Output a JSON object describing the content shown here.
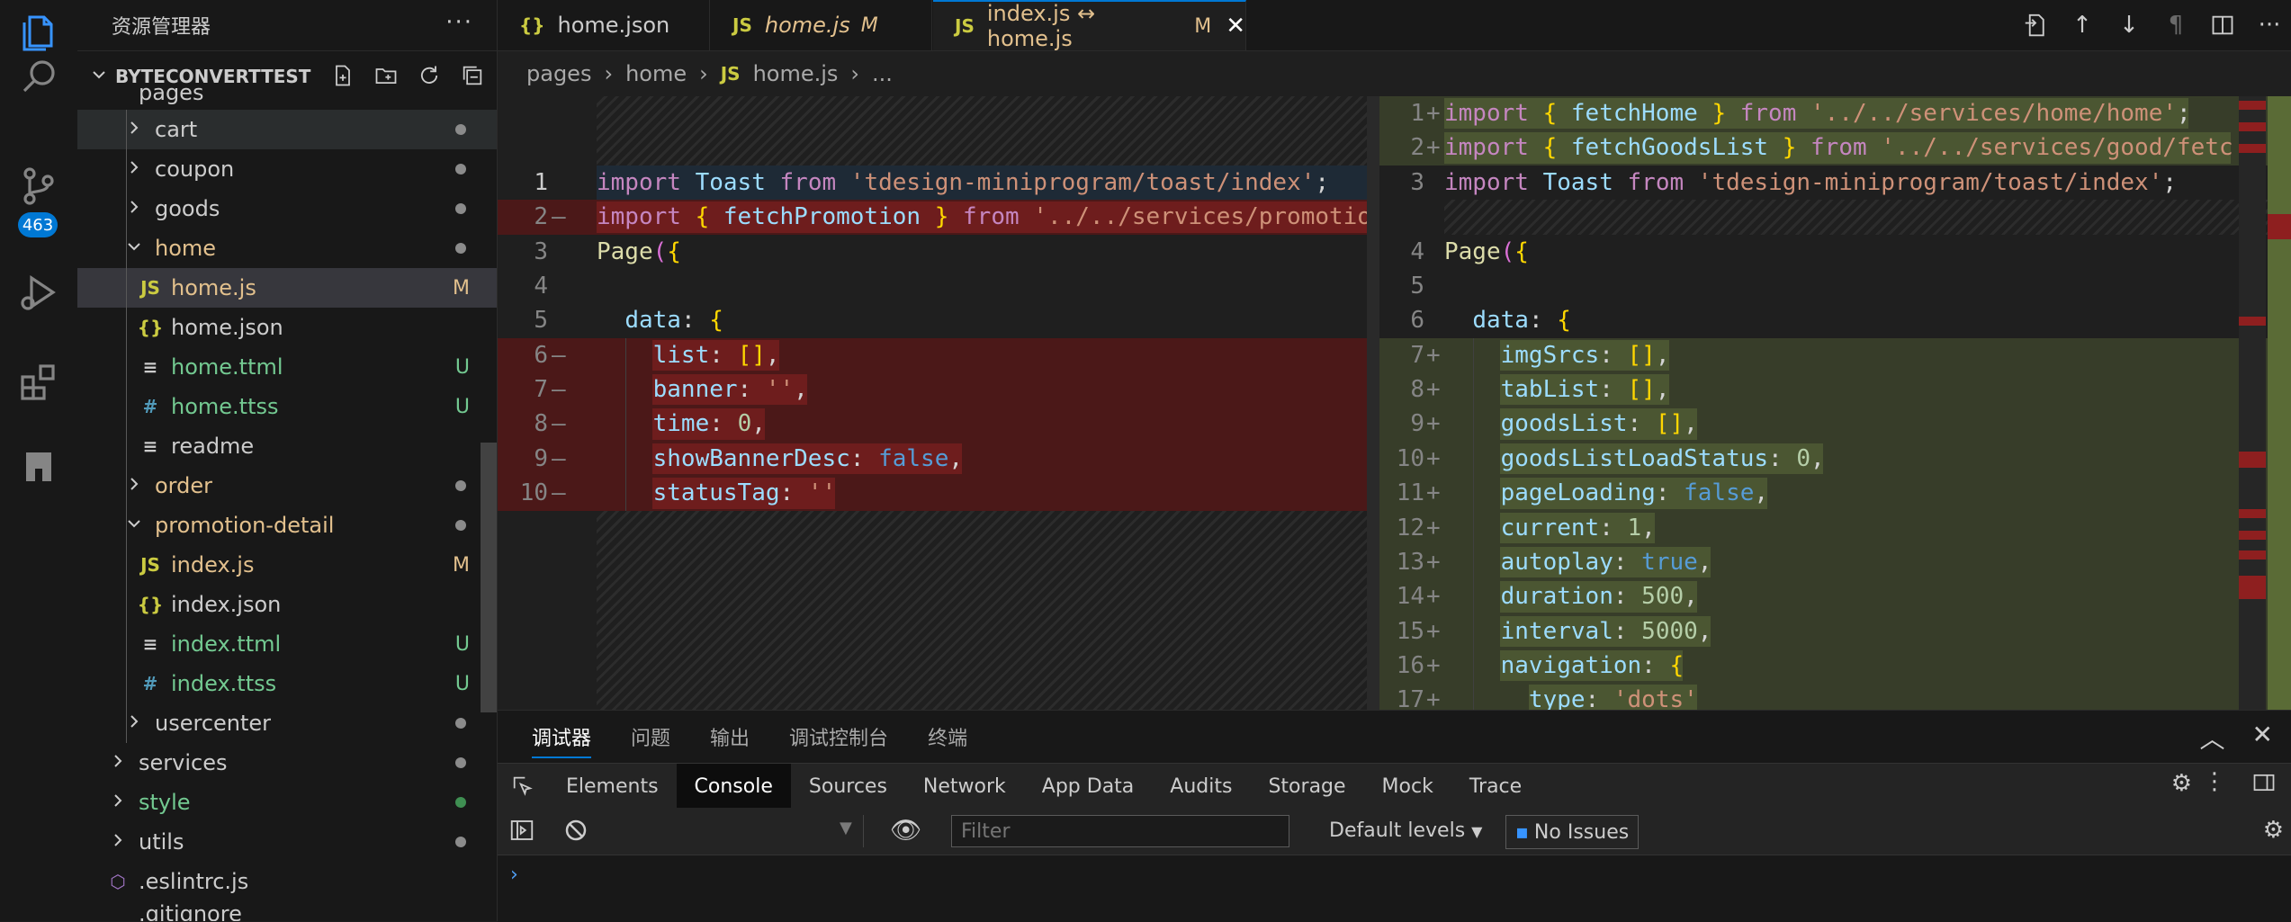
{
  "activity": {
    "items": [
      "explorer",
      "search",
      "source-control",
      "run-debug",
      "extensions",
      "mini-program"
    ],
    "scm_badge": "463"
  },
  "sidebar": {
    "title": "资源管理器",
    "more": "···",
    "project": "BYTECONVERTTEST",
    "partial_top": "pages",
    "partial_bottom": ".gitignore",
    "tree": [
      {
        "label": "cart",
        "type": "folder",
        "open": false,
        "level": 1,
        "status": "dot",
        "color": "#cccccc"
      },
      {
        "label": "coupon",
        "type": "folder",
        "open": false,
        "level": 1,
        "status": "dot",
        "color": "#cccccc"
      },
      {
        "label": "goods",
        "type": "folder",
        "open": false,
        "level": 1,
        "status": "dot",
        "color": "#cccccc"
      },
      {
        "label": "home",
        "type": "folder",
        "open": true,
        "level": 1,
        "status": "dot",
        "color": "#e2c08d"
      },
      {
        "label": "home.js",
        "type": "js",
        "level": 2,
        "status": "M",
        "color": "#e2c08d"
      },
      {
        "label": "home.json",
        "type": "json",
        "level": 2,
        "status": "",
        "color": "#cccccc"
      },
      {
        "label": "home.ttml",
        "type": "ttml",
        "level": 2,
        "status": "U",
        "color": "#73c991"
      },
      {
        "label": "home.ttss",
        "type": "ttss",
        "level": 2,
        "status": "U",
        "color": "#73c991"
      },
      {
        "label": "readme",
        "type": "text",
        "level": 2,
        "status": "",
        "color": "#cccccc"
      },
      {
        "label": "order",
        "type": "folder",
        "open": false,
        "level": 1,
        "status": "dot",
        "color": "#e2c08d"
      },
      {
        "label": "promotion-detail",
        "type": "folder",
        "open": true,
        "level": 1,
        "status": "dot",
        "color": "#e2c08d"
      },
      {
        "label": "index.js",
        "type": "js",
        "level": 2,
        "status": "M",
        "color": "#e2c08d"
      },
      {
        "label": "index.json",
        "type": "json",
        "level": 2,
        "status": "",
        "color": "#cccccc"
      },
      {
        "label": "index.ttml",
        "type": "ttml",
        "level": 2,
        "status": "U",
        "color": "#73c991"
      },
      {
        "label": "index.ttss",
        "type": "ttss",
        "level": 2,
        "status": "U",
        "color": "#73c991"
      },
      {
        "label": "usercenter",
        "type": "folder",
        "open": false,
        "level": 1,
        "status": "dot",
        "color": "#cccccc"
      },
      {
        "label": "services",
        "type": "folder",
        "open": false,
        "level": 0,
        "status": "dot",
        "color": "#cccccc"
      },
      {
        "label": "style",
        "type": "folder",
        "open": false,
        "level": 0,
        "status": "dot-green",
        "color": "#73c991"
      },
      {
        "label": "utils",
        "type": "folder",
        "open": false,
        "level": 0,
        "status": "dot",
        "color": "#cccccc"
      },
      {
        "label": ".eslintrc.js",
        "type": "eslint",
        "level": 0,
        "status": "",
        "color": "#cccccc"
      }
    ]
  },
  "tabs": [
    {
      "icon": "{}",
      "label": "home.json",
      "modified": "",
      "active": false,
      "italic": false
    },
    {
      "icon": "JS",
      "label": "home.js",
      "modified": "M",
      "active": false,
      "italic": true
    },
    {
      "icon": "JS",
      "label": "index.js ↔ home.js",
      "modified": "M",
      "active": true,
      "italic": false
    }
  ],
  "breadcrumb": [
    "pages",
    "home",
    "home.js",
    "..."
  ],
  "left_pane": {
    "lines": [
      {
        "n": "1",
        "marker": "",
        "code": "import Toast from 'tdesign-miniprogram/toast/index';"
      },
      {
        "n": "2",
        "marker": "—",
        "code": "import { fetchPromotion } from '../../services/promotion"
      },
      {
        "n": "3",
        "marker": "",
        "code": "Page({"
      },
      {
        "n": "4",
        "marker": "",
        "code": ""
      },
      {
        "n": "5",
        "marker": "",
        "code": "  data: {"
      },
      {
        "n": "6",
        "marker": "—",
        "code": "    list: [],"
      },
      {
        "n": "7",
        "marker": "—",
        "code": "    banner: '',"
      },
      {
        "n": "8",
        "marker": "—",
        "code": "    time: 0,"
      },
      {
        "n": "9",
        "marker": "—",
        "code": "    showBannerDesc: false,"
      },
      {
        "n": "10",
        "marker": "—",
        "code": "    statusTag: ''"
      }
    ]
  },
  "right_pane": {
    "lines": [
      {
        "n": "1",
        "marker": "+",
        "code": "import { fetchHome } from '../../services/home/home';"
      },
      {
        "n": "2",
        "marker": "+",
        "code": "import { fetchGoodsList } from '../../services/good/fetc"
      },
      {
        "n": "3",
        "marker": "",
        "code": "import Toast from 'tdesign-miniprogram/toast/index';"
      },
      {
        "n": "4",
        "marker": "",
        "code": "Page({"
      },
      {
        "n": "5",
        "marker": "",
        "code": ""
      },
      {
        "n": "6",
        "marker": "",
        "code": "  data: {"
      },
      {
        "n": "7",
        "marker": "+",
        "code": "    imgSrcs: [],"
      },
      {
        "n": "8",
        "marker": "+",
        "code": "    tabList: [],"
      },
      {
        "n": "9",
        "marker": "+",
        "code": "    goodsList: [],"
      },
      {
        "n": "10",
        "marker": "+",
        "code": "    goodsListLoadStatus: 0,"
      },
      {
        "n": "11",
        "marker": "+",
        "code": "    pageLoading: false,"
      },
      {
        "n": "12",
        "marker": "+",
        "code": "    current: 1,"
      },
      {
        "n": "13",
        "marker": "+",
        "code": "    autoplay: true,"
      },
      {
        "n": "14",
        "marker": "+",
        "code": "    duration: 500,"
      },
      {
        "n": "15",
        "marker": "+",
        "code": "    interval: 5000,"
      },
      {
        "n": "16",
        "marker": "+",
        "code": "    navigation: {"
      },
      {
        "n": "17",
        "marker": "+",
        "code": "      type: 'dots'"
      }
    ]
  },
  "panel": {
    "tabs": [
      "调试器",
      "问题",
      "输出",
      "调试控制台",
      "终端"
    ],
    "active_tab": "调试器",
    "devtools_tabs": [
      "Elements",
      "Console",
      "Sources",
      "Network",
      "App Data",
      "Audits",
      "Storage",
      "Mock",
      "Trace"
    ],
    "active_devtools_tab": "Console",
    "filter_placeholder": "Filter",
    "levels": "Default levels",
    "issues": "No Issues",
    "prompt": "›"
  }
}
